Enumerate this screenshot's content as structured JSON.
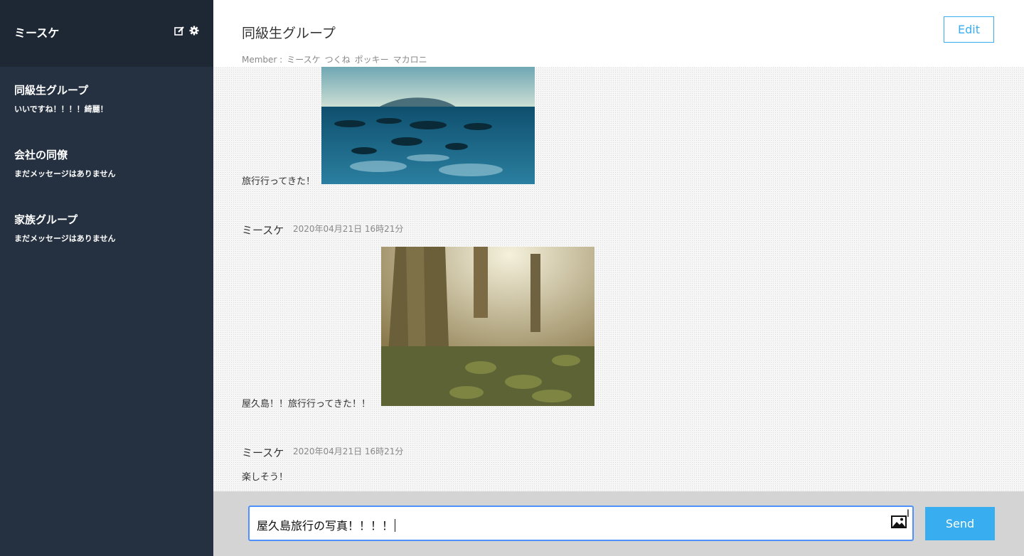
{
  "sidebar": {
    "user_name": "ミースケ",
    "icons": [
      "edit-icon",
      "gear-icon"
    ],
    "groups": [
      {
        "name": "同級生グループ",
        "last_message": "いいですね！！！！綺麗！"
      },
      {
        "name": "会社の同僚",
        "last_message": "まだメッセージはありません"
      },
      {
        "name": "家族グループ",
        "last_message": "まだメッセージはありません"
      }
    ]
  },
  "header": {
    "title": "同級生グループ",
    "members_label": "Member :",
    "members": [
      "ミースケ",
      "つくね",
      "ポッキー",
      "マカロニ"
    ],
    "edit_label": "Edit"
  },
  "messages": [
    {
      "user": "",
      "date": "",
      "text": "旅行行ってきた！",
      "image": "ocean-photo"
    },
    {
      "user": "ミースケ",
      "date": "2020年04月21日 16時21分",
      "text": "屋久島！！旅行行ってきた！！",
      "image": "forest-photo"
    },
    {
      "user": "ミースケ",
      "date": "2020年04月21日 16時21分",
      "text": "楽しそう！",
      "image": ""
    }
  ],
  "composer": {
    "value": "屋久島旅行の写真！！！！",
    "send_label": "Send",
    "image_icon": "image-upload-icon"
  },
  "colors": {
    "sidebar_bg": "#253141",
    "sidebar_header_bg": "#1e2835",
    "accent": "#38aef0",
    "input_focus": "#4d90fe",
    "footer_bg": "#d4d4d4"
  }
}
